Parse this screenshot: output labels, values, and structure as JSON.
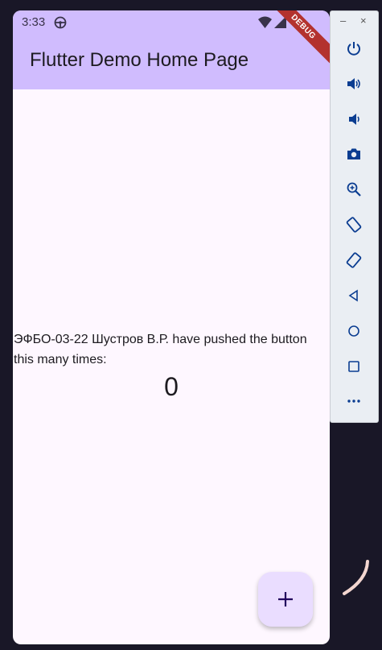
{
  "status_bar": {
    "time": "3:33"
  },
  "app_bar": {
    "title": "Flutter Demo Home Page"
  },
  "debug_banner": {
    "label": "DEBUG"
  },
  "body": {
    "counter_label": "ЭФБО-03-22 Шустров В.Р. have pushed the button this many times:",
    "counter_value": "0"
  },
  "fab": {
    "icon": "plus-icon",
    "symbol": "+"
  },
  "emulator_toolbar": {
    "window_controls": {
      "minimize": "–",
      "close": "×"
    },
    "tools": [
      "power-icon",
      "volume-up-icon",
      "volume-down-icon",
      "camera-icon",
      "zoom-icon",
      "rotate-left-icon",
      "rotate-right-icon",
      "back-icon",
      "home-icon",
      "overview-icon",
      "more-icon"
    ]
  },
  "colors": {
    "app_bar": "#d0bcfe",
    "surface": "#fef7ff",
    "fab": "#eaddff",
    "debug_banner": "#b3322e",
    "background": "#191727",
    "toolbar": "#eaeef3"
  }
}
